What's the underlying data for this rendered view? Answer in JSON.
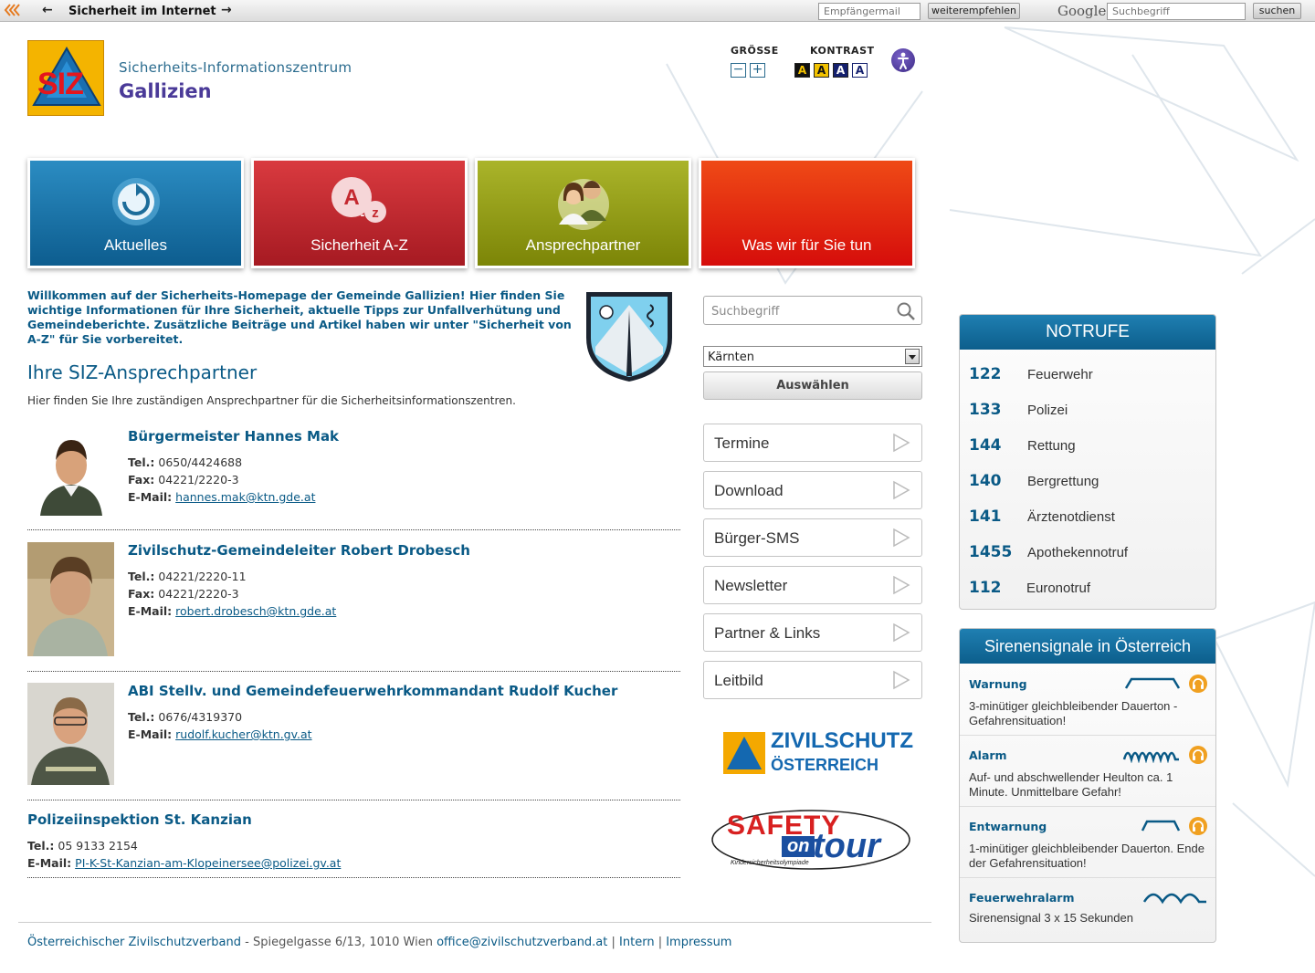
{
  "toolbar": {
    "page_name": "Sicherheit im Internet",
    "email_placeholder": "Empfängermail",
    "recommend_label": "weiterempfehlen",
    "google_label": "Google",
    "search_placeholder": "Suchbegriff",
    "search_label": "suchen"
  },
  "header": {
    "logo_text": "SIZ",
    "subtitle": "Sicherheits-Informationszentrum",
    "title": "Gallizien",
    "size_label": "GRÖSSE",
    "size_minus": "−",
    "size_plus": "+",
    "contrast_label": "KONTRAST",
    "contrast_options": [
      "A",
      "A",
      "A",
      "A"
    ]
  },
  "tiles": [
    {
      "label": "Aktuelles",
      "color": "#1a76a8"
    },
    {
      "label": "Sicherheit A-Z",
      "color": "#c4282f"
    },
    {
      "label": "Ansprechpartner",
      "color": "#8f9a10"
    },
    {
      "label": "Was wir für Sie tun",
      "color": "#e0260f"
    }
  ],
  "tile_icon_text": {
    "a": "A",
    "z": "z",
    "dash": "-"
  },
  "welcome_text": "Willkommen auf der Sicherheits-Homepage der Gemeinde Gallizien! Hier finden Sie wichtige Informationen für Ihre Sicherheit, aktuelle Tipps zur Unfallverhütung und Gemeindeberichte. Zusätzliche Beiträge und Artikel haben wir unter \"Sicherheit von A-Z\" für Sie vorbereitet.",
  "section": {
    "title": "Ihre SIZ-Ansprechpartner",
    "intro": "Hier finden Sie Ihre zuständigen Ansprechpartner für die Sicherheitsinformationszentren."
  },
  "labels": {
    "tel": "Tel.:",
    "fax": "Fax:",
    "email": "E-Mail:"
  },
  "contacts": [
    {
      "name": "Bürgermeister Hannes Mak",
      "tel": "0650/4424688",
      "fax": "04221/2220-3",
      "email": "hannes.mak@ktn.gde.at"
    },
    {
      "name": "Zivilschutz-Gemeindeleiter Robert Drobesch",
      "tel": "04221/2220-11",
      "fax": "04221/2220-3",
      "email": "robert.drobesch@ktn.gde.at"
    },
    {
      "name": "ABI Stellv. und Gemeindefeuerwehrkommandant Rudolf Kucher",
      "tel": "0676/4319370",
      "email": "rudolf.kucher@ktn.gv.at"
    },
    {
      "name": "Polizeiinspektion St. Kanzian",
      "tel": "05 9133 2154",
      "email": "PI-K-St-Kanzian-am-Klopeinersee@polizei.gv.at"
    }
  ],
  "sidebar": {
    "search_placeholder": "Suchbegriff",
    "region_selected": "Kärnten",
    "apply_label": "Auswählen",
    "menu": [
      "Termine",
      "Download",
      "Bürger-SMS",
      "Newsletter",
      "Partner & Links",
      "Leitbild"
    ],
    "zivilschutz_line1": "ZIVILSCHUTZ",
    "zivilschutz_line2": "ÖSTERREICH",
    "safety_line1": "SAFETY",
    "safety_on": "on",
    "safety_tour": "tour",
    "safety_small": "Kindersicherheitsolympiade"
  },
  "notrufe": {
    "title": "NOTRUFE",
    "items": [
      {
        "number": "122",
        "name": "Feuerwehr"
      },
      {
        "number": "133",
        "name": "Polizei"
      },
      {
        "number": "144",
        "name": "Rettung"
      },
      {
        "number": "140",
        "name": "Bergrettung"
      },
      {
        "number": "141",
        "name": "Ärztenotdienst"
      },
      {
        "number": "1455",
        "name": "Apothekennotruf"
      },
      {
        "number": "112",
        "name": "Euronotruf"
      }
    ]
  },
  "sirens": {
    "title": "Sirenensignale in Österreich",
    "items": [
      {
        "name": "Warnung",
        "desc": "3-minütiger gleichbleibender Dauerton - Gefahrensituation!"
      },
      {
        "name": "Alarm",
        "desc": "Auf- und abschwellender Heulton ca. 1 Minute. Unmittelbare Gefahr!"
      },
      {
        "name": "Entwarnung",
        "desc": "1-minütiger gleichbleibender Dauerton. Ende der Gefahrensituation!"
      },
      {
        "name": "Feuerwehralarm",
        "desc": "Sirenensignal 3 x 15 Sekunden"
      }
    ]
  },
  "footer": {
    "org": "Österreichischer Zivilschutzverband",
    "address": " - Spiegelgasse 6/13, 1010 Wien ",
    "email": "office@zivilschutzverband.at",
    "sep": " | ",
    "intern": "Intern",
    "impressum": "Impressum"
  },
  "colors": {
    "accent": "#0a5a86",
    "brand": "#4a3a98",
    "header_blue": "#1575a8"
  }
}
